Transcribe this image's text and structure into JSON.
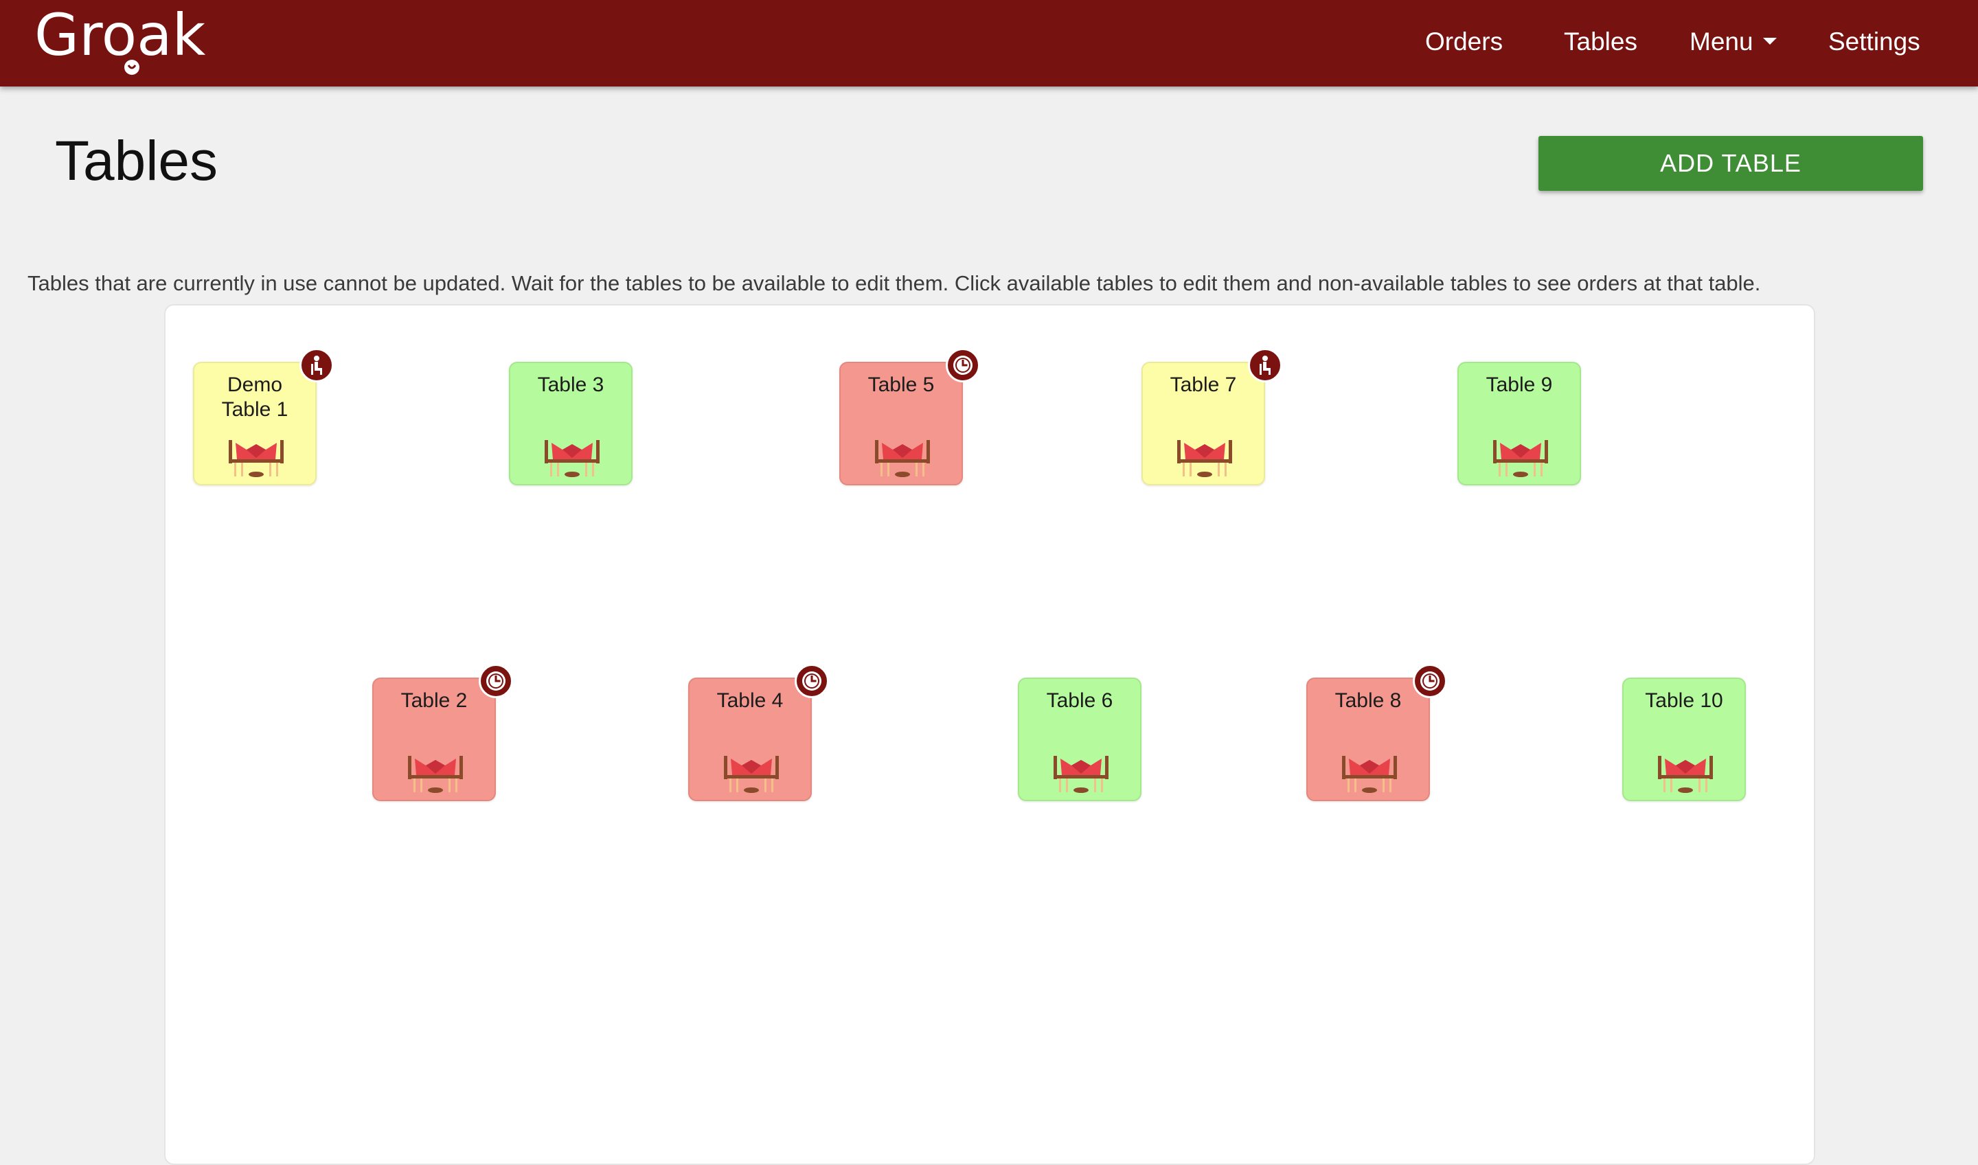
{
  "brand": {
    "logo_text": "Groak"
  },
  "nav": {
    "orders": "Orders",
    "tables": "Tables",
    "menu": "Menu",
    "settings": "Settings"
  },
  "page": {
    "title": "Tables",
    "add_button": "ADD TABLE",
    "info": "Tables that are currently in use cannot be updated. Wait for the tables to be available to edit them. Click available tables to edit them and non-available tables to see orders at that table."
  },
  "colors": {
    "navbar": "#76120f",
    "seated": "#fdfca7",
    "available": "#b6fa9e",
    "waiting": "#f4988f",
    "add_button": "#3f8e36"
  },
  "tables": [
    {
      "name": "Demo Table 1",
      "status": "seated",
      "badge": "person-seated-icon"
    },
    {
      "name": "Table 3",
      "status": "available",
      "badge": ""
    },
    {
      "name": "Table 5",
      "status": "waiting",
      "badge": "clock-icon"
    },
    {
      "name": "Table 7",
      "status": "seated",
      "badge": "person-seated-icon"
    },
    {
      "name": "Table 9",
      "status": "available",
      "badge": ""
    },
    {
      "name": "Table 2",
      "status": "waiting",
      "badge": "clock-icon"
    },
    {
      "name": "Table 4",
      "status": "waiting",
      "badge": "clock-icon"
    },
    {
      "name": "Table 6",
      "status": "available",
      "badge": ""
    },
    {
      "name": "Table 8",
      "status": "waiting",
      "badge": "clock-icon"
    },
    {
      "name": "Table 10",
      "status": "available",
      "badge": ""
    }
  ]
}
